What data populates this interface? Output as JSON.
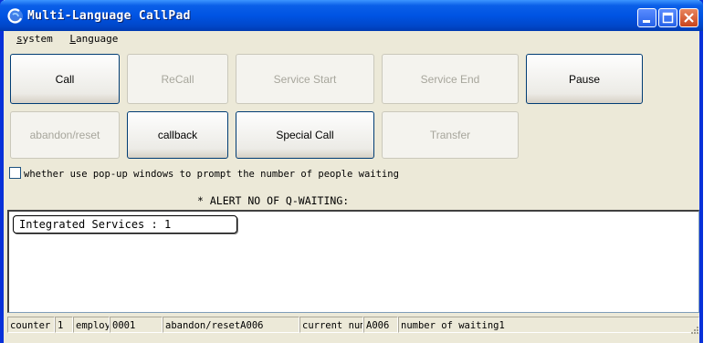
{
  "window": {
    "title": "Multi-Language CallPad"
  },
  "menu": {
    "items": [
      {
        "label_u": "s",
        "label_rest": "ystem"
      },
      {
        "label_u": "L",
        "label_rest": "anguage"
      }
    ]
  },
  "buttons": {
    "call": "Call",
    "recall": "ReCall",
    "service_start": "Service Start",
    "service_end": "Service End",
    "pause": "Pause",
    "abandon": "abandon/reset",
    "callback": "callback",
    "special_call": "Special Call",
    "transfer": "Transfer"
  },
  "options": {
    "popup_label": "whether use pop-up windows to prompt the number of people waiting",
    "popup_checked": false
  },
  "alert": {
    "text": "* ALERT NO OF Q-WAITING:"
  },
  "queue": {
    "service": "Integrated Services : 1"
  },
  "status": {
    "counter_label": "counter",
    "counter_value": "1",
    "employ_label": "employ",
    "employ_value": "0001",
    "last_action": "abandon/resetA006",
    "current_label": "current num",
    "current_value": "A006",
    "waiting_text": "number of waiting1"
  }
}
